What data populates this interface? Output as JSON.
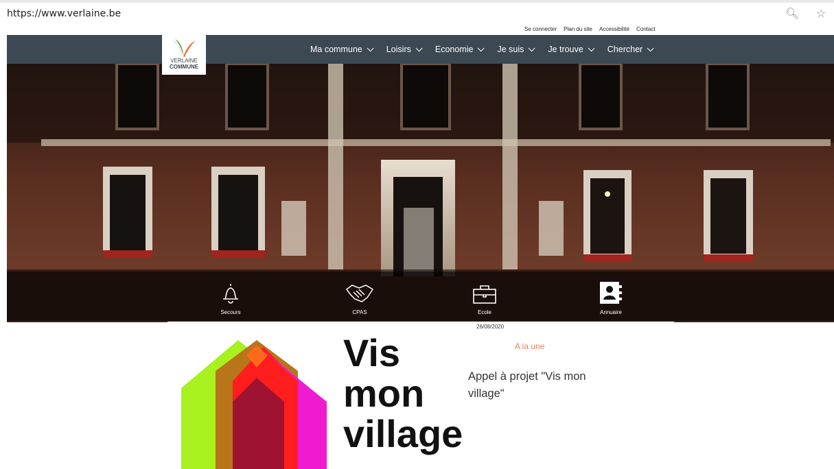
{
  "browser": {
    "url": "https://www.verlaine.be",
    "zoom_icon": "zoom-icon",
    "favorite_icon": "star-icon"
  },
  "top_links": [
    "Se connecter",
    "Plan du site",
    "Accessibilité",
    "Contact"
  ],
  "logo": {
    "line1": "VERLAINE",
    "line2": "COMMUNE"
  },
  "nav": [
    "Ma commune",
    "Loisirs",
    "Economie",
    "Je suis",
    "Je trouve",
    "Chercher"
  ],
  "quick_links": [
    {
      "label": "Secours",
      "icon": "bell-icon"
    },
    {
      "label": "CPAS",
      "icon": "handshake-icon"
    },
    {
      "label": "Ecole",
      "icon": "briefcase-icon"
    },
    {
      "label": "Annuaire",
      "icon": "contact-book-icon"
    }
  ],
  "article": {
    "date": "26/08/2020",
    "category": "A la une",
    "title": "Appel à projet \"Vis mon village\"",
    "image_text": [
      "Vis",
      "mon",
      "village"
    ]
  },
  "colors": {
    "header_bg": "#3c4852",
    "accent": "#f07a55",
    "logo_green": "#8dc63f",
    "logo_orange": "#f26522"
  }
}
